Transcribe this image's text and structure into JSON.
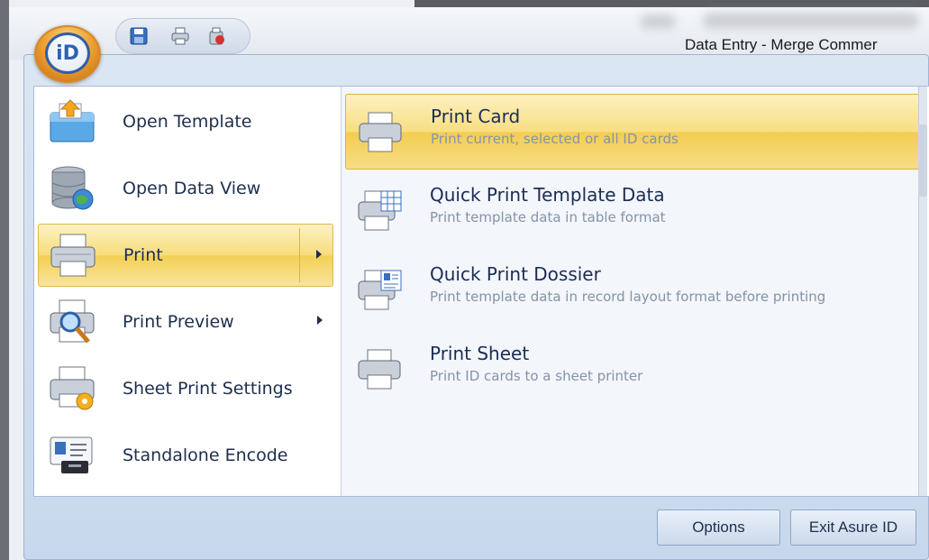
{
  "window": {
    "title": "Data Entry - Merge Commer"
  },
  "app_button": {
    "label": "iD"
  },
  "quick_access": {
    "icons": [
      "save-icon",
      "print-icon",
      "recycle-icon"
    ]
  },
  "menu": {
    "items": [
      {
        "label": "Open Template",
        "icon": "open-template-icon",
        "has_submenu": false,
        "active": false
      },
      {
        "label": "Open Data View",
        "icon": "database-icon",
        "has_submenu": false,
        "active": false
      },
      {
        "label": "Print",
        "icon": "printer-icon",
        "has_submenu": true,
        "active": true
      },
      {
        "label": "Print Preview",
        "icon": "print-preview-icon",
        "has_submenu": true,
        "active": false
      },
      {
        "label": "Sheet Print Settings",
        "icon": "sheet-print-settings-icon",
        "has_submenu": false,
        "active": false
      },
      {
        "label": "Standalone Encode",
        "icon": "encode-icon",
        "has_submenu": false,
        "active": false
      }
    ]
  },
  "submenu": {
    "items": [
      {
        "title": "Print Card",
        "description": "Print current, selected or all ID cards",
        "icon": "printer-icon",
        "active": true
      },
      {
        "title": "Quick Print Template Data",
        "description": "Print template data in table format",
        "icon": "table-printer-icon",
        "active": false
      },
      {
        "title": "Quick Print Dossier",
        "description": "Print template data in record layout format before printing",
        "icon": "dossier-printer-icon",
        "active": false
      },
      {
        "title": "Print Sheet",
        "description": "Print ID cards to a sheet printer",
        "icon": "printer-icon",
        "active": false
      }
    ]
  },
  "footer": {
    "options_label": "Options",
    "exit_label": "Exit Asure ID"
  },
  "colors": {
    "highlight": "#f3cf55",
    "menu_bg": "#c8d8ec",
    "text": "#1d2e4e",
    "desc_text": "#8593a8"
  }
}
